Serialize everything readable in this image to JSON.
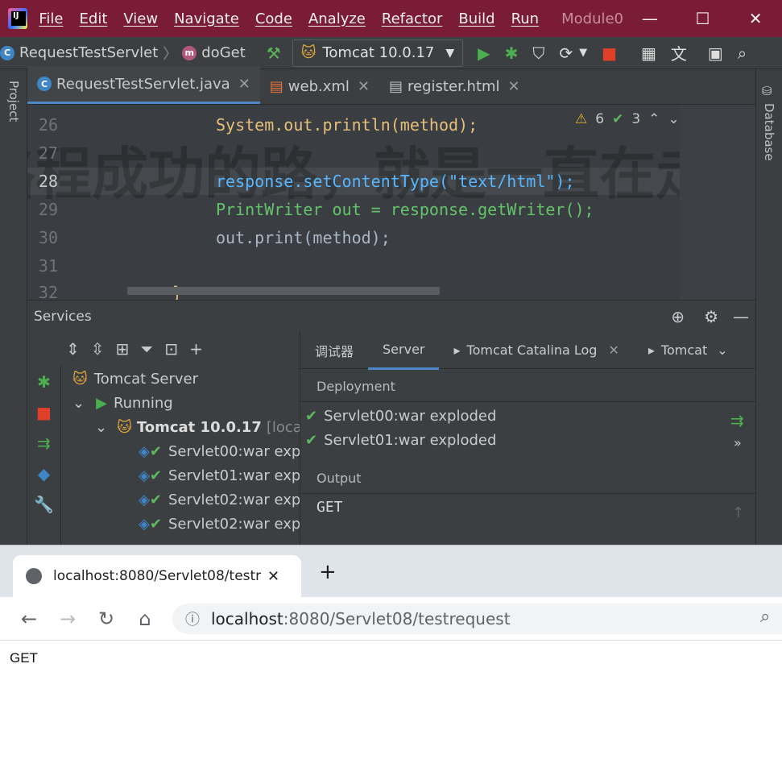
{
  "title_bar": {
    "menu": [
      "File",
      "Edit",
      "View",
      "Navigate",
      "Code",
      "Analyze",
      "Refactor",
      "Build",
      "Run"
    ],
    "module": "Module0",
    "minimize": "—",
    "maximize": "☐",
    "close": "✕"
  },
  "nav": {
    "breadcrumb_class": "RequestTestServlet",
    "breadcrumb_sep": "〉",
    "breadcrumb_method": "doGet",
    "run_config": "Tomcat 10.0.17"
  },
  "tabs": [
    {
      "label": "RequestTestServlet.java",
      "active": true
    },
    {
      "label": "web.xml",
      "active": false
    },
    {
      "label": "register.html",
      "active": false
    }
  ],
  "side": {
    "project": "Project",
    "database": "Database"
  },
  "editor": {
    "warnings": "6",
    "checks": "3",
    "lines": [
      {
        "n": "26",
        "code": "System.out.println(method);"
      },
      {
        "n": "27",
        "code": ""
      },
      {
        "n": "28",
        "code": "response.setContentType(\"text/html\");"
      },
      {
        "n": "29",
        "code": "PrintWriter out = response.getWriter();"
      },
      {
        "n": "30",
        "code": "out.print(method);"
      },
      {
        "n": "31",
        "code": ""
      },
      {
        "n": "32",
        "code": "}"
      }
    ],
    "watermark": "路程成功的路，就是一直在走"
  },
  "services": {
    "title": "Services",
    "tree": {
      "root": "Tomcat Server",
      "running": "Running",
      "server": "Tomcat 10.0.17",
      "server_tag": "[local]",
      "artifacts": [
        "Servlet00:war exp",
        "Servlet01:war exp",
        "Servlet02:war exp",
        "Servlet02:war exp"
      ]
    },
    "tabs": [
      "调试器",
      "Server",
      "Tomcat Catalina Log",
      "Tomcat"
    ],
    "deployment_label": "Deployment",
    "deployments": [
      "Servlet00:war exploded",
      "Servlet01:war exploded"
    ],
    "output_label": "Output",
    "output": "GET"
  },
  "browser": {
    "tab_title": "localhost:8080/Servlet08/testr",
    "new_tab": "+",
    "url_host": "localhost",
    "url_path": ":8080/Servlet08/testrequest",
    "page_text": "GET"
  }
}
